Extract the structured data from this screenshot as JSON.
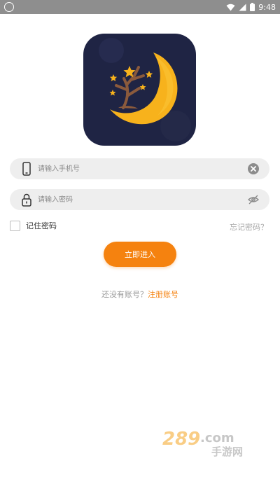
{
  "status_bar": {
    "time": "9:48",
    "icons": [
      "notification-icon",
      "wifi-icon",
      "signal-icon",
      "battery-icon"
    ]
  },
  "logo": {
    "icons": [
      "moon-icon",
      "tree-icon",
      "star-icon"
    ],
    "colors": {
      "background": "#1f2444",
      "moon": "#f7b21c",
      "tree": "#8b5a3c"
    }
  },
  "login_form": {
    "phone": {
      "placeholder": "请输入手机号",
      "value": ""
    },
    "password": {
      "placeholder": "请输入密码",
      "value": ""
    },
    "remember_label": "记住密码",
    "forgot_label": "忘记密码？",
    "submit_label": "立即进入",
    "register_prompt": "还没有账号？",
    "register_link": "注册账号"
  },
  "watermark": {
    "text": "289.com",
    "sub_text": "手游网"
  },
  "colors": {
    "accent": "#f5820f",
    "field_bg": "#eeeeee",
    "muted_text": "#9a9a9a"
  }
}
